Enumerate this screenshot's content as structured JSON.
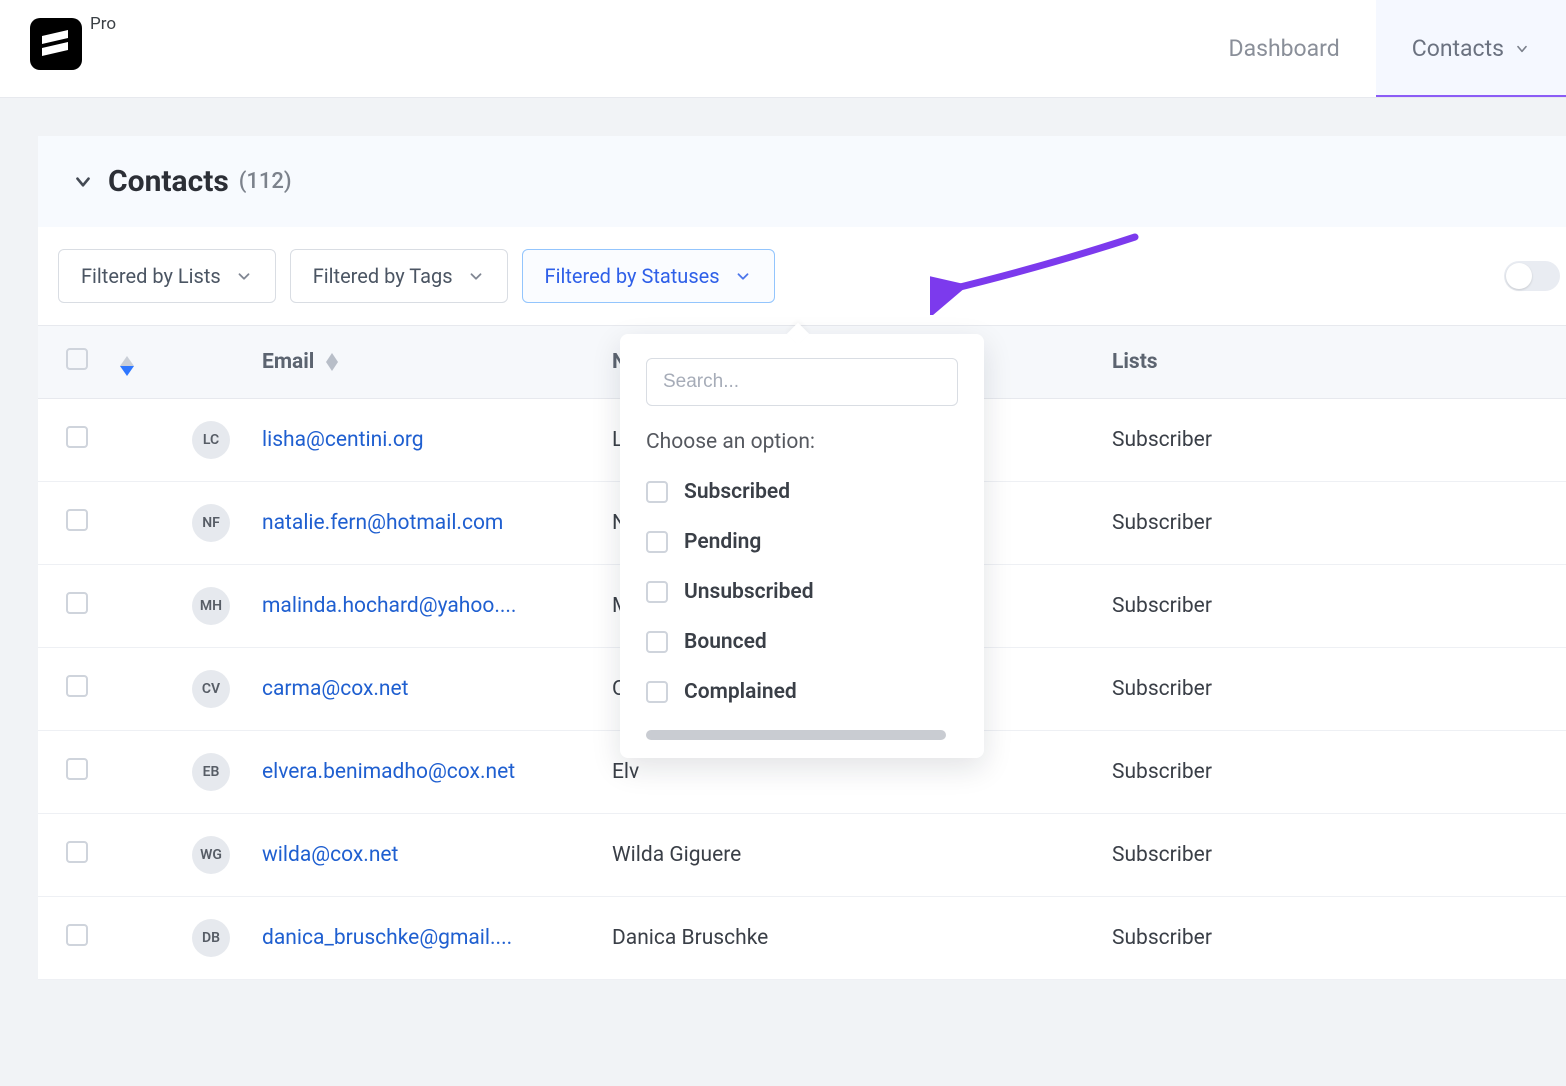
{
  "brand": {
    "badge": "Pro"
  },
  "nav": {
    "dashboard": "Dashboard",
    "contacts": "Contacts"
  },
  "header": {
    "title": "Contacts",
    "count_display": "(112)"
  },
  "filters": {
    "lists": "Filtered by Lists",
    "tags": "Filtered by Tags",
    "statuses": "Filtered by Statuses"
  },
  "columns": {
    "email": "Email",
    "name": "Na",
    "lists": "Lists"
  },
  "rows": [
    {
      "initials": "LC",
      "email": "lisha@centini.org",
      "name": "Lis",
      "lists": "Subscriber"
    },
    {
      "initials": "NF",
      "email": "natalie.fern@hotmail.com",
      "name": "Na",
      "lists": "Subscriber"
    },
    {
      "initials": "MH",
      "email": "malinda.hochard@yahoo....",
      "name": "Ma",
      "lists": "Subscriber"
    },
    {
      "initials": "CV",
      "email": "carma@cox.net",
      "name": "Ca",
      "lists": "Subscriber"
    },
    {
      "initials": "EB",
      "email": "elvera.benimadho@cox.net",
      "name": "Elv",
      "lists": "Subscriber"
    },
    {
      "initials": "WG",
      "email": "wilda@cox.net",
      "name": "Wilda Giguere",
      "lists": "Subscriber"
    },
    {
      "initials": "DB",
      "email": "danica_bruschke@gmail....",
      "name": "Danica Bruschke",
      "lists": "Subscriber"
    }
  ],
  "status_dropdown": {
    "search_placeholder": "Search...",
    "choose_label": "Choose an option:",
    "options": [
      "Subscribed",
      "Pending",
      "Unsubscribed",
      "Bounced",
      "Complained"
    ]
  }
}
